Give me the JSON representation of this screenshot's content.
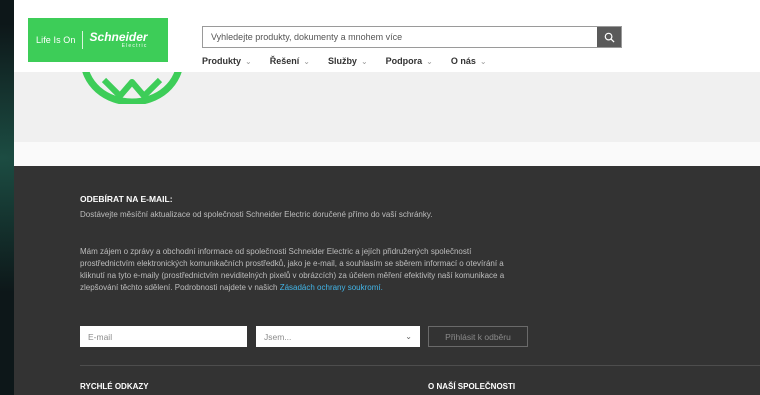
{
  "header": {
    "logo": {
      "tagline": "Life Is On",
      "brand": "Schneider",
      "sub": "Electric"
    },
    "search": {
      "placeholder": "Vyhledejte produkty, dokumenty a mnohem více"
    },
    "nav": [
      {
        "label": "Produkty"
      },
      {
        "label": "Řešení"
      },
      {
        "label": "Služby"
      },
      {
        "label": "Podpora"
      },
      {
        "label": "O nás"
      }
    ]
  },
  "footer": {
    "newsletter_title": "ODEBÍRAT NA E-MAIL:",
    "newsletter_lead": "Dostávejte měsíční aktualizace od společnosti Schneider Electric doručené přímo do vaší schránky.",
    "consent_text": "Mám zájem o zprávy a obchodní informace od společnosti Schneider Electric a jejích přidružených společností prostřednictvím elektronických komunikačních prostředků, jako je e-mail, a souhlasím se sběrem informací o otevírání a kliknutí na tyto e-maily (prostřednictvím neviditelných pixelů v obrázcích) za účelem měření efektivity naší komunikace a zlepšování těchto sdělení. Podrobnosti najdete v našich ",
    "consent_link": "Zásadách ochrany soukromí.",
    "email_placeholder": "E-mail",
    "select_value": "Jsem...",
    "subscribe_label": "Přihlásit k odběru",
    "quick_links_title": "RYCHLÉ ODKAZY",
    "about_title": "O NAŠÍ SPOLEČNOSTI"
  },
  "colors": {
    "brand_green": "#3dcd58",
    "footer_bg": "#333333",
    "link": "#42b4e6"
  },
  "icons": [
    "search-icon",
    "chevron-down-icon",
    "logo-mark"
  ]
}
